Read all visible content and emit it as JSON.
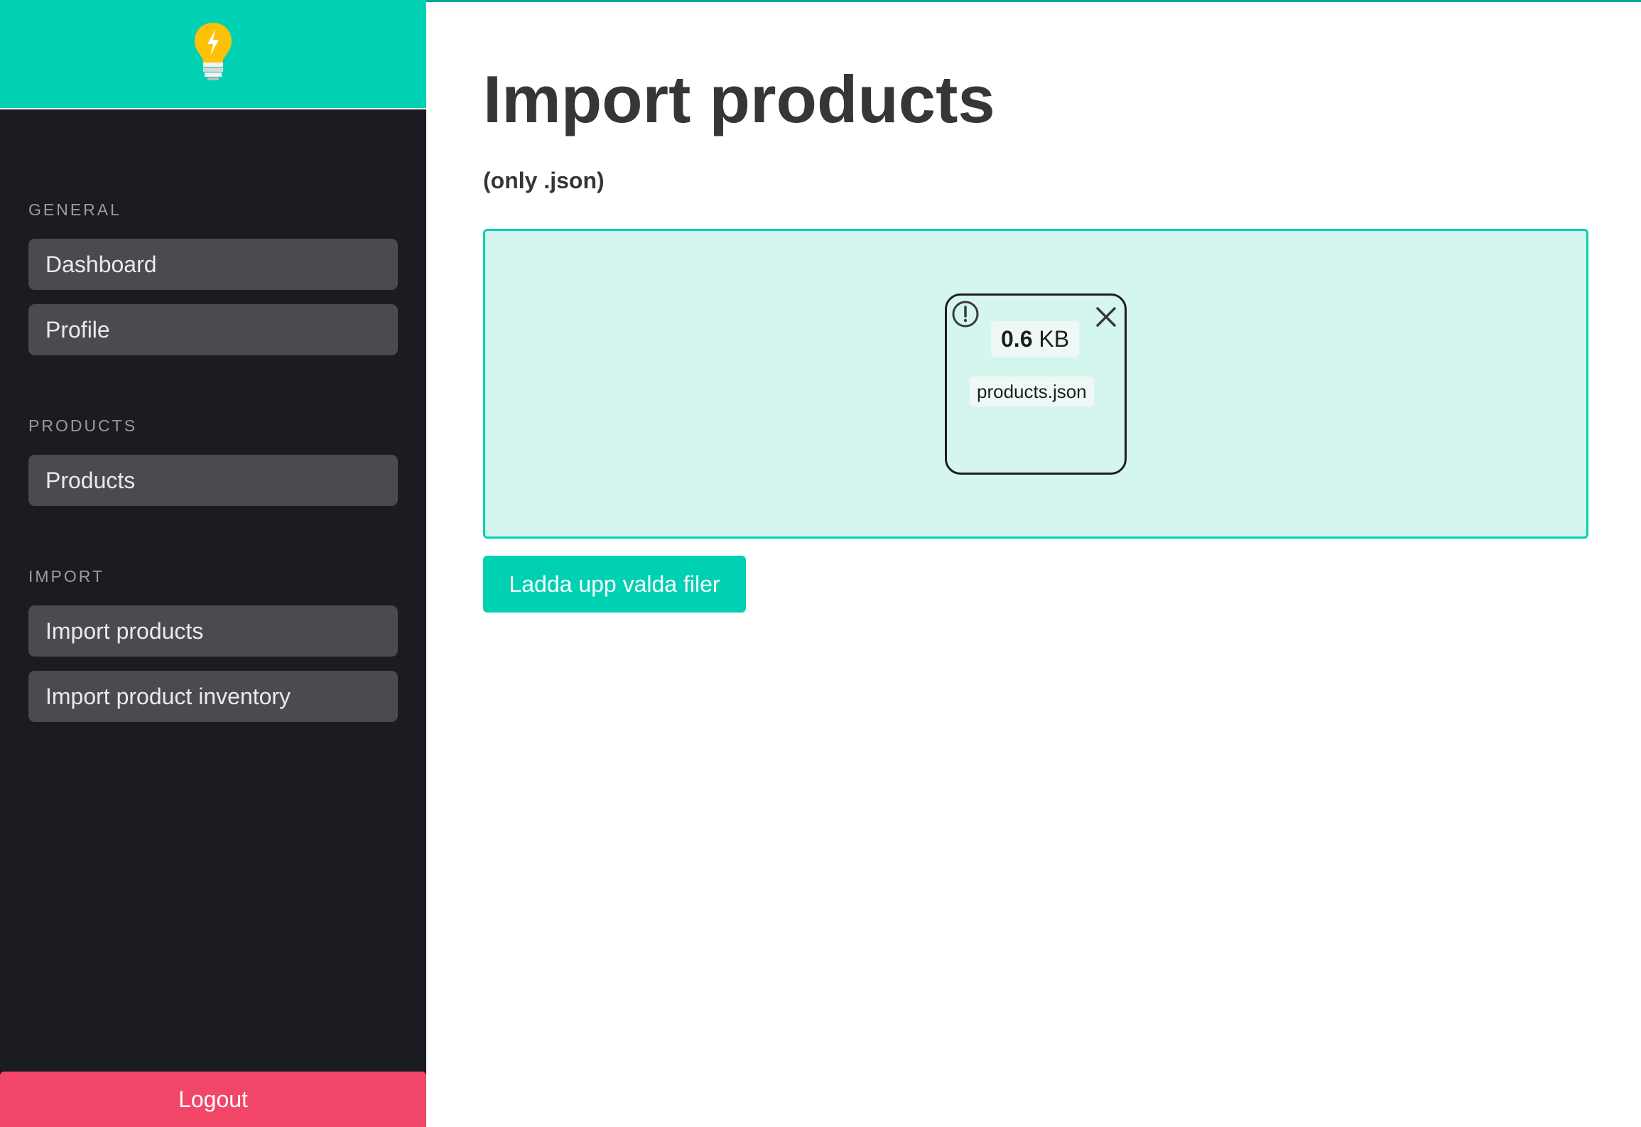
{
  "sidebar": {
    "logo_icon": "lightbulb-bolt-icon",
    "sections": [
      {
        "label": "GENERAL",
        "items": [
          {
            "label": "Dashboard"
          },
          {
            "label": "Profile"
          }
        ]
      },
      {
        "label": "PRODUCTS",
        "items": [
          {
            "label": "Products"
          }
        ]
      },
      {
        "label": "IMPORT",
        "items": [
          {
            "label": "Import products"
          },
          {
            "label": "Import product inventory"
          }
        ]
      }
    ],
    "logout_label": "Logout"
  },
  "main": {
    "title": "Import products",
    "subtitle": "(only .json)",
    "dropzone": {
      "file": {
        "size_value": "0.6",
        "size_unit": "KB",
        "name": "products.json",
        "status_icon": "alert-circle-icon",
        "remove_icon": "close-icon"
      }
    },
    "upload_button_label": "Ladda upp valda filer"
  },
  "colors": {
    "brand": "#00d1b2",
    "sidebar_bg": "#1b1c21",
    "menu_item_bg": "#4a4b50",
    "logout": "#f14668",
    "dropzone_bg": "#d5f6ef"
  }
}
